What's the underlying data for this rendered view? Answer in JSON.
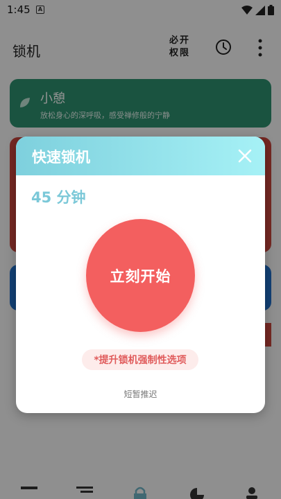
{
  "status_bar": {
    "time": "1:45",
    "notification_letter": "A"
  },
  "app_bar": {
    "title": "锁机",
    "permission_line1": "必开",
    "permission_line2": "权限"
  },
  "cards": {
    "rest": {
      "title": "小憩",
      "description": "放松身心的深呼吸，感受禅修般的宁静"
    }
  },
  "dialog": {
    "title": "快速锁机",
    "duration": "45 分钟",
    "start_label": "立刻开始",
    "strict_label": "*提升锁机强制性选项",
    "postpone_label": "短暂推迟"
  },
  "colors": {
    "accent_cyan": "#7bc8d8",
    "start_red": "#f35f5f",
    "rest_green": "#2e8f6e",
    "card_red": "#c8453d",
    "card_blue": "#1f6fc9"
  }
}
